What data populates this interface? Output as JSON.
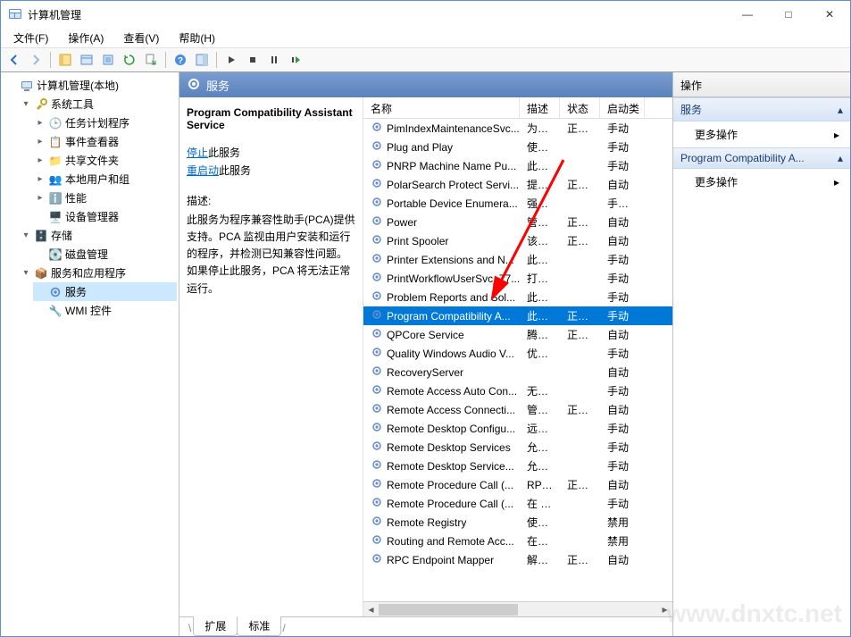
{
  "window": {
    "title": "计算机管理",
    "min": "—",
    "max": "□",
    "close": "✕"
  },
  "menu": {
    "file": "文件(F)",
    "action": "操作(A)",
    "view": "查看(V)",
    "help": "帮助(H)"
  },
  "tree": {
    "root": "计算机管理(本地)",
    "system_tools": "系统工具",
    "task_scheduler": "任务计划程序",
    "event_viewer": "事件查看器",
    "shared_folders": "共享文件夹",
    "local_users": "本地用户和组",
    "performance": "性能",
    "device_manager": "设备管理器",
    "storage": "存储",
    "disk_mgmt": "磁盘管理",
    "services_apps": "服务和应用程序",
    "services": "服务",
    "wmi": "WMI 控件"
  },
  "center": {
    "header": "服务",
    "tab_ext": "扩展",
    "tab_std": "标准"
  },
  "detail": {
    "name": "Program Compatibility Assistant Service",
    "stop_link": "停止",
    "restart_link": "重启动",
    "stop_suffix": "此服务",
    "restart_suffix": "此服务",
    "desc_label": "描述:",
    "desc": "此服务为程序兼容性助手(PCA)提供支持。PCA 监视由用户安装和运行的程序，并检测已知兼容性问题。如果停止此服务，PCA 将无法正常运行。"
  },
  "columns": {
    "name": "名称",
    "desc": "描述",
    "status": "状态",
    "startup": "启动类"
  },
  "services": [
    {
      "name": "PimIndexMaintenanceSvc...",
      "desc": "为联...",
      "status": "正在...",
      "startup": "手动"
    },
    {
      "name": "Plug and Play",
      "desc": "使计...",
      "status": "",
      "startup": "手动"
    },
    {
      "name": "PNRP Machine Name Pu...",
      "desc": "此服...",
      "status": "",
      "startup": "手动"
    },
    {
      "name": "PolarSearch Protect Servi...",
      "desc": "提供...",
      "status": "正在...",
      "startup": "自动"
    },
    {
      "name": "Portable Device Enumera...",
      "desc": "强制...",
      "status": "",
      "startup": "手动(触"
    },
    {
      "name": "Power",
      "desc": "管理...",
      "status": "正在...",
      "startup": "自动"
    },
    {
      "name": "Print Spooler",
      "desc": "该服...",
      "status": "正在...",
      "startup": "自动"
    },
    {
      "name": "Printer Extensions and N...",
      "desc": "此服...",
      "status": "",
      "startup": "手动"
    },
    {
      "name": "PrintWorkflowUserSvc_77...",
      "desc": "打印...",
      "status": "",
      "startup": "手动"
    },
    {
      "name": "Problem Reports and Sol...",
      "desc": "此服...",
      "status": "",
      "startup": "手动"
    },
    {
      "name": "Program Compatibility A...",
      "desc": "此服...",
      "status": "正在...",
      "startup": "手动",
      "selected": true
    },
    {
      "name": "QPCore Service",
      "desc": "腾讯...",
      "status": "正在...",
      "startup": "自动"
    },
    {
      "name": "Quality Windows Audio V...",
      "desc": "优质 ...",
      "status": "",
      "startup": "手动"
    },
    {
      "name": "RecoveryServer",
      "desc": "",
      "status": "",
      "startup": "自动"
    },
    {
      "name": "Remote Access Auto Con...",
      "desc": "无论...",
      "status": "",
      "startup": "手动"
    },
    {
      "name": "Remote Access Connecti...",
      "desc": "管理...",
      "status": "正在...",
      "startup": "自动"
    },
    {
      "name": "Remote Desktop Configu...",
      "desc": "远程...",
      "status": "",
      "startup": "手动"
    },
    {
      "name": "Remote Desktop Services",
      "desc": "允许...",
      "status": "",
      "startup": "手动"
    },
    {
      "name": "Remote Desktop Service...",
      "desc": "允许...",
      "status": "",
      "startup": "手动"
    },
    {
      "name": "Remote Procedure Call (...",
      "desc": "RPC...",
      "status": "正在...",
      "startup": "自动"
    },
    {
      "name": "Remote Procedure Call (...",
      "desc": "在 W...",
      "status": "",
      "startup": "手动"
    },
    {
      "name": "Remote Registry",
      "desc": "使远...",
      "status": "",
      "startup": "禁用"
    },
    {
      "name": "Routing and Remote Acc...",
      "desc": "在局...",
      "status": "",
      "startup": "禁用"
    },
    {
      "name": "RPC Endpoint Mapper",
      "desc": "解析 ...",
      "status": "正在...",
      "startup": "自动"
    }
  ],
  "actions": {
    "header": "操作",
    "group1": "服务",
    "more1": "更多操作",
    "group2": "Program Compatibility A...",
    "more2": "更多操作"
  }
}
